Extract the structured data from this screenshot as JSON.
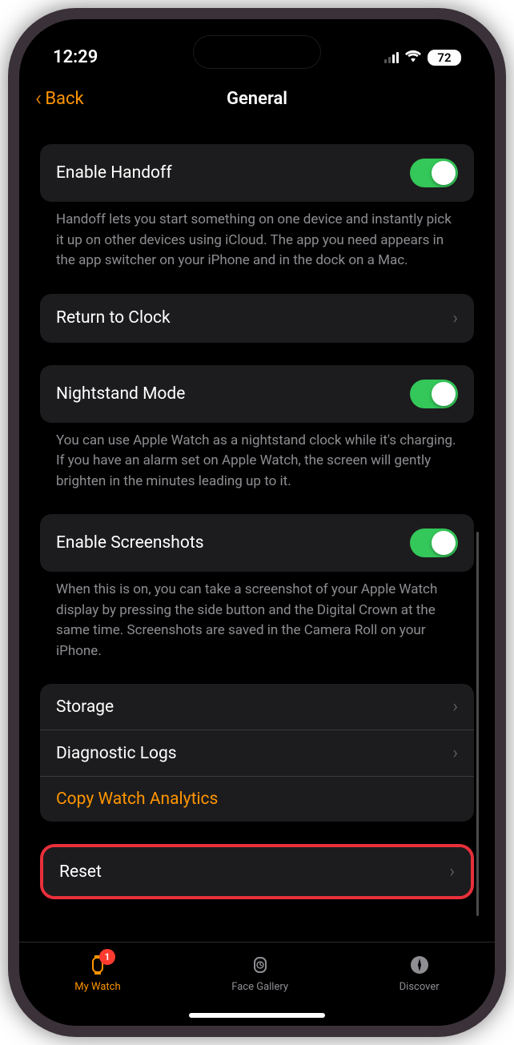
{
  "status": {
    "time": "12:29",
    "battery": "72"
  },
  "nav": {
    "back": "Back",
    "title": "General"
  },
  "handoff": {
    "label": "Enable Handoff",
    "description": "Handoff lets you start something on one device and instantly pick it up on other devices using iCloud. The app you need appears in the app switcher on your iPhone and in the dock on a Mac."
  },
  "returnClock": {
    "label": "Return to Clock"
  },
  "nightstand": {
    "label": "Nightstand Mode",
    "description": "You can use Apple Watch as a nightstand clock while it's charging. If you have an alarm set on Apple Watch, the screen will gently brighten in the minutes leading up to it."
  },
  "screenshots": {
    "label": "Enable Screenshots",
    "description": "When this is on, you can take a screenshot of your Apple Watch display by pressing the side button and the Digital Crown at the same time. Screenshots are saved in the Camera Roll on your iPhone."
  },
  "storage": {
    "label": "Storage"
  },
  "diagnostics": {
    "label": "Diagnostic Logs"
  },
  "analytics": {
    "label": "Copy Watch Analytics"
  },
  "reset": {
    "label": "Reset"
  },
  "tabs": {
    "myWatch": "My Watch",
    "badge": "1",
    "faceGallery": "Face Gallery",
    "discover": "Discover"
  }
}
